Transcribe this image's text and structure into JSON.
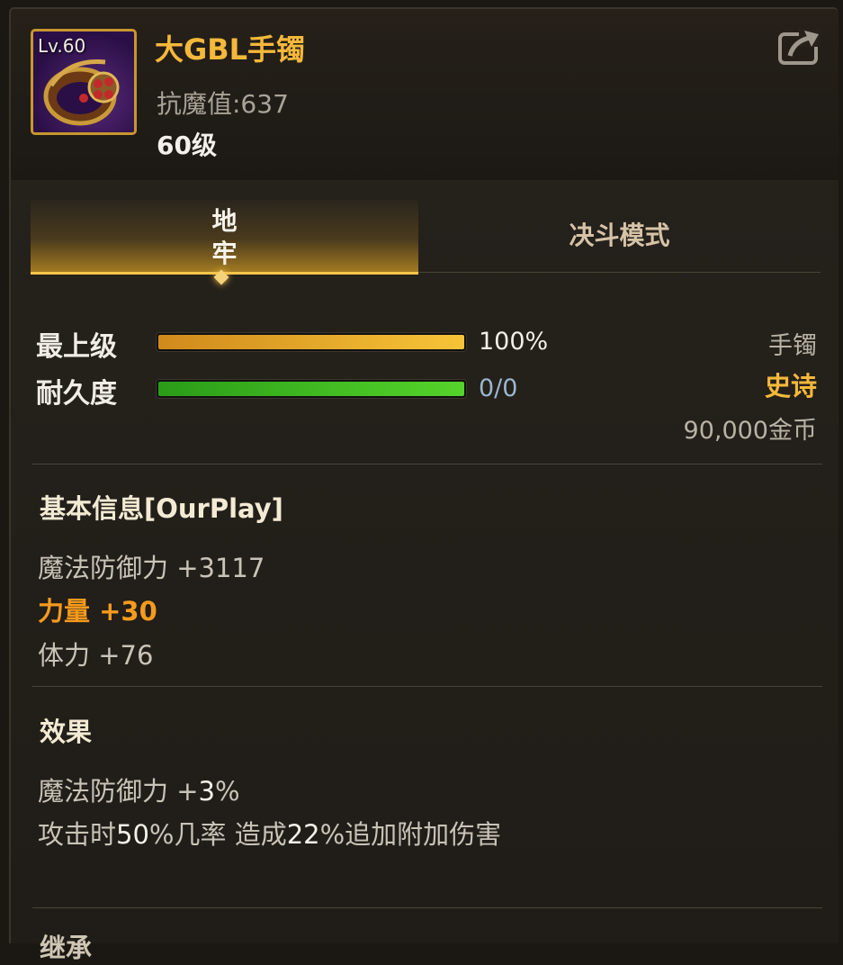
{
  "item": {
    "level_badge": "Lv.60",
    "name": "大GBL手镯",
    "magic_resist": "抗魔值:637",
    "level_text": "60级"
  },
  "tabs": [
    {
      "label": "地牢",
      "active": true
    },
    {
      "label": "决斗模式",
      "active": false
    }
  ],
  "stats": {
    "grade_label": "最上级",
    "grade_value": "100%",
    "grade_fraction": 1.0,
    "durability_label": "耐久度",
    "durability_value": "0/0",
    "durability_fraction": 1.0
  },
  "meta": {
    "type": "手镯",
    "rarity": "史诗",
    "price": "90,000金币"
  },
  "basic_info": {
    "title": "基本信息[OurPlay]",
    "magic_def": "魔法防御力 +3117",
    "strength": "力量 +30",
    "stamina": "体力 +76"
  },
  "effects": {
    "title": "效果",
    "line1_prefix": "魔法防御力 +",
    "line1_value": "3",
    "line1_suffix": "%",
    "line2_a": "攻击时",
    "line2_b": "50",
    "line2_c": "%几率 造成",
    "line2_d": "22",
    "line2_e": "%追加附加伤害"
  },
  "next_section_peek": "继承",
  "colors": {
    "title_gold": "#f4b83a",
    "rarity": "#f4b83a",
    "strength_orange": "#f59a1e",
    "grade_bar": "#f0b42a",
    "durability_bar": "#3fc21e"
  },
  "icons": {
    "share": "share-arrow-icon",
    "tab_marker": "diamond-marker-icon"
  }
}
